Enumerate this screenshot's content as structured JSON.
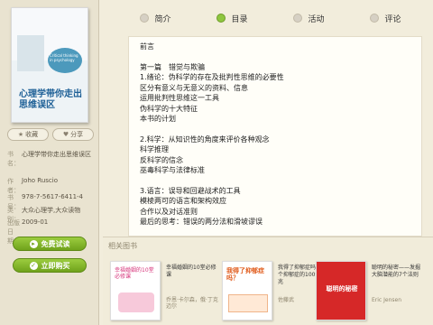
{
  "book": {
    "cover_title": "心理学带你走出思维误区",
    "cover_subtitle": "Critical thinking in psychology",
    "buttons": {
      "favorite": "收藏",
      "share": "分享"
    },
    "meta": [
      {
        "key": "书名：",
        "value": "心理学带你走出思维误区"
      },
      {
        "key": "作者：",
        "value": "Joho Ruscio"
      },
      {
        "key": "书号：",
        "value": "978-7-5617-6411-4"
      },
      {
        "key": "类别：",
        "value": "大众心理学,大众读物"
      },
      {
        "key": "出版日期：",
        "value": "2009-01"
      }
    ],
    "trial_button": "免费试读",
    "buy_button": "立即购买"
  },
  "tabs": [
    {
      "label": "简介",
      "active": false
    },
    {
      "label": "目录",
      "active": true
    },
    {
      "label": "活动",
      "active": false
    },
    {
      "label": "评论",
      "active": false
    }
  ],
  "toc": {
    "l0": "前言",
    "l1": "第一篇　错觉与欺骗",
    "l2": "1.绪论：伪科学的存在及批判性思维的必要性",
    "l3": "区分有意义与无意义的资料、信息",
    "l4": "运用批判性思维这一工具",
    "l5": "伪科学的十大特征",
    "l6": "本书的计划",
    "l7": "2.科学：从知识性的角度来评价各种观念",
    "l8": "科学推理",
    "l9": "反科学的信念",
    "l10": "巫毒科学与法律标准",
    "l11": "3.语言：误导和回避战术的工具",
    "l12": "模棱两可的语言和架构效应",
    "l13": "合作以及对话准则",
    "l14": "最后的思考：错误的两分法和滑坡谬误"
  },
  "related": {
    "header": "相关图书",
    "books": [
      {
        "title": "幸福婚姻的10堂必修课",
        "author": "乔恩·卡尔森，俄·丁克迈尔",
        "cover_text": "幸福婚姻的10堂必修课",
        "accent": "#d6337a"
      },
      {
        "title": "我得了抑郁症吗？一个抑郁症的100个征兆",
        "author": "佐藤武",
        "cover_text": "我得了抑郁症吗？",
        "accent": "#e05a1a"
      },
      {
        "title": "聪明的秘密——发掘大脑潜能的7个法则",
        "author": "Eric Jensen",
        "cover_text": "聪明的秘密",
        "accent": "#d62828"
      }
    ]
  }
}
